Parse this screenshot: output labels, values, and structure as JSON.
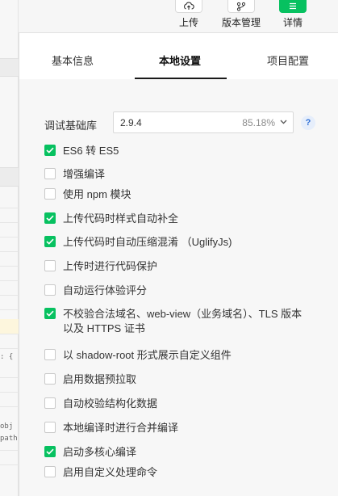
{
  "toolbar": {
    "upload_label": "上传",
    "version_label": "版本管理",
    "details_label": "详情"
  },
  "panel": {
    "tabs": [
      "基本信息",
      "本地设置",
      "项目配置"
    ],
    "active_tab": "本地设置",
    "library": {
      "label": "调试基础库",
      "value": "2.9.4",
      "percent": "85.18%",
      "help": "?"
    },
    "options": [
      {
        "label": "ES6 转 ES5",
        "checked": true
      },
      {
        "label": "增强编译",
        "checked": false
      },
      {
        "label": "使用 npm 模块",
        "checked": false
      },
      {
        "label": "上传代码时样式自动补全",
        "checked": true
      },
      {
        "label": "上传代码时自动压缩混淆 （UglifyJs)",
        "checked": true
      },
      {
        "label": "上传时进行代码保护",
        "checked": false
      },
      {
        "label": "自动运行体验评分",
        "checked": false
      },
      {
        "label": "不校验合法域名、web-view（业务域名）、TLS 版本以及 HTTPS 证书",
        "checked": true
      },
      {
        "label": "以 shadow-root 形式展示自定义组件",
        "checked": false
      },
      {
        "label": "启用数据预拉取",
        "checked": false
      },
      {
        "label": "自动校验结构化数据",
        "checked": false
      },
      {
        "label": "本地编译时进行合并编译",
        "checked": false
      },
      {
        "label": "启动多核心编译",
        "checked": true
      },
      {
        "label": "启用自定义处理命令",
        "checked": false
      }
    ]
  },
  "editor_fragments": [
    ": {",
    "obj",
    "path"
  ],
  "colors": {
    "accent": "#07c160",
    "help": "#2f6fd6"
  }
}
